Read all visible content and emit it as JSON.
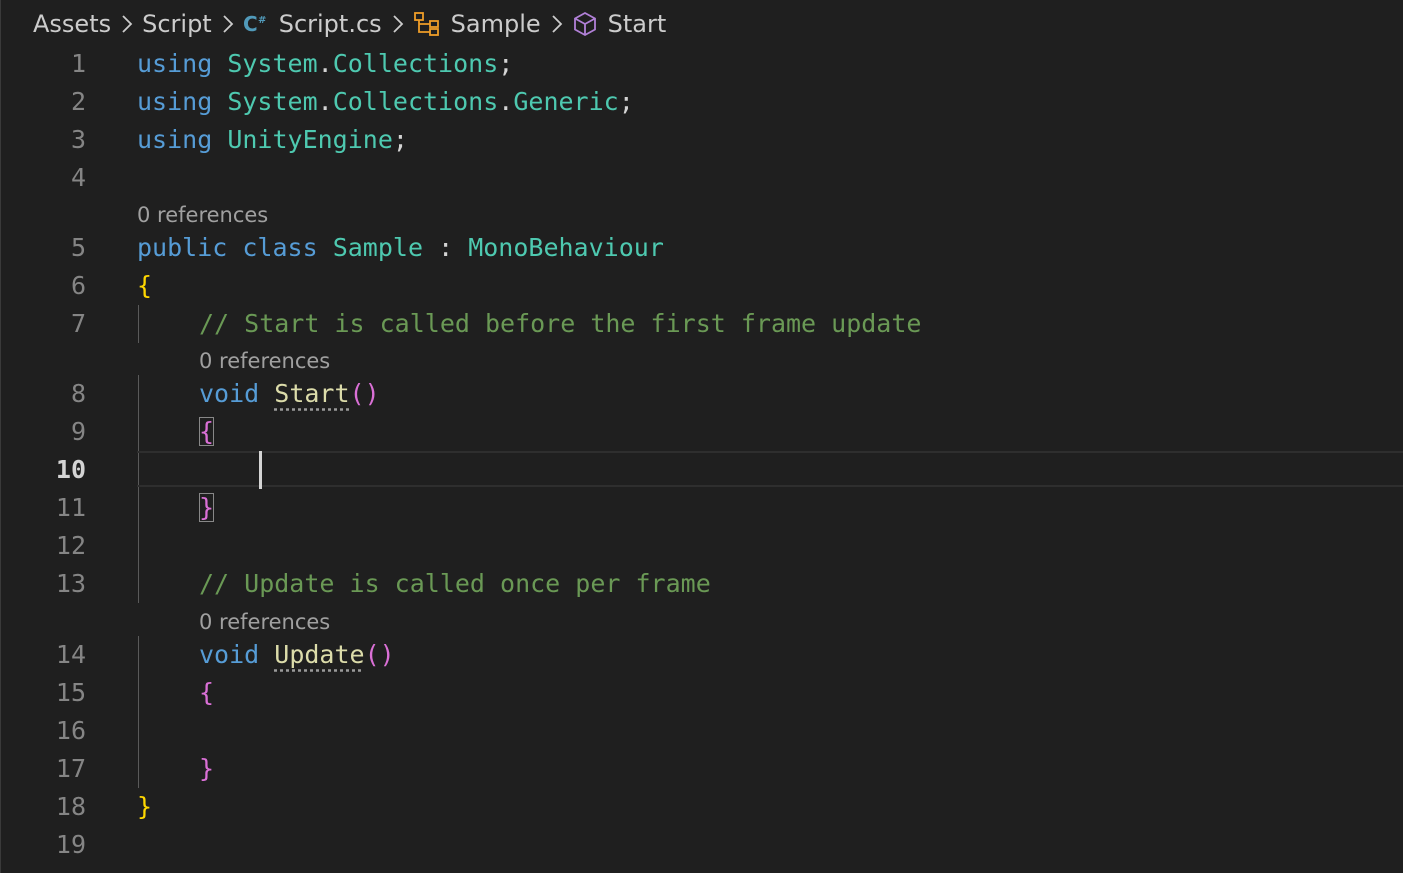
{
  "breadcrumb": {
    "items": [
      {
        "label": "Assets",
        "icon": null
      },
      {
        "label": "Script",
        "icon": null
      },
      {
        "label": "Script.cs",
        "icon": "csharp-file-icon"
      },
      {
        "label": "Sample",
        "icon": "class-icon"
      },
      {
        "label": "Start",
        "icon": "method-cube-icon"
      }
    ],
    "separator_icon": "chevron-right-icon"
  },
  "codelens": {
    "class_refs": "0 references",
    "start_refs": "0 references",
    "update_refs": "0 references"
  },
  "line_numbers": [
    "1",
    "2",
    "3",
    "4",
    "5",
    "6",
    "7",
    "8",
    "9",
    "10",
    "11",
    "12",
    "13",
    "14",
    "15",
    "16",
    "17",
    "18",
    "19"
  ],
  "active_line": "10",
  "code": {
    "l1": {
      "kw": "using",
      "ns1": "System",
      "dot": ".",
      "ns2": "Collections",
      "semi": ";"
    },
    "l2": {
      "kw": "using",
      "ns1": "System",
      "dot1": ".",
      "ns2": "Collections",
      "dot2": ".",
      "ns3": "Generic",
      "semi": ";"
    },
    "l3": {
      "kw": "using",
      "ns1": "UnityEngine",
      "semi": ";"
    },
    "l5": {
      "kw1": "public",
      "kw2": "class",
      "name": "Sample",
      "colon": ":",
      "base": "MonoBehaviour"
    },
    "l6": {
      "brace": "{"
    },
    "l7": {
      "comment": "// Start is called before the first frame update"
    },
    "l8": {
      "kw": "void",
      "fn": "Start",
      "parens": "()"
    },
    "l9": {
      "brace": "{"
    },
    "l11": {
      "brace": "}"
    },
    "l13": {
      "comment": "// Update is called once per frame"
    },
    "l14": {
      "kw": "void",
      "fn": "Update",
      "parens": "()"
    },
    "l15": {
      "brace": "{"
    },
    "l17": {
      "brace": "}"
    },
    "l18": {
      "brace": "}"
    }
  },
  "colors": {
    "background": "#1f1f1f",
    "keyword": "#569cd6",
    "type": "#4ec9b0",
    "function": "#dcdcaa",
    "comment": "#6a9955",
    "bracket_level1": "#ffd700",
    "bracket_level2": "#da70d6"
  }
}
